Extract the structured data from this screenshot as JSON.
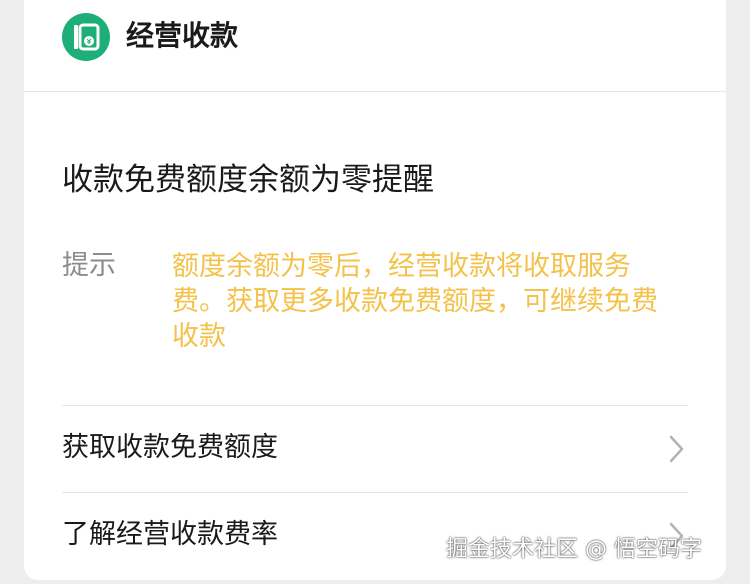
{
  "header": {
    "logo_icon": "merchant-payment-logo-icon",
    "app_name": "经营收款",
    "accent_color": "#1eae7a"
  },
  "message": {
    "title": "收款免费额度余额为零提醒",
    "hint_label": "提示",
    "hint_text": "额度余额为零后，经营收款将收取服务费。获取更多收款免费额度，可继续免费收款",
    "hint_color": "#f4c24a"
  },
  "links": [
    {
      "label": "获取收款免费额度",
      "icon": "chevron-right-icon"
    },
    {
      "label": "了解经营收款费率",
      "icon": "chevron-right-icon"
    }
  ],
  "watermark": "掘金技术社区 @ 悟空码字"
}
